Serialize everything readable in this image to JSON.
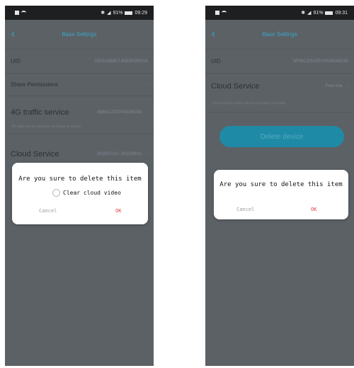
{
  "left": {
    "status": {
      "icons_left": "▮ ≋",
      "bluetooth": "✱",
      "signal": "◢",
      "battery_percent": "91%",
      "time": "09:29"
    },
    "nav": {
      "title": "Base Settings"
    },
    "uid": {
      "label": "UID",
      "value": "VEGUABMLTJKBSFDPDVA"
    },
    "share": {
      "label": "Share Permissions"
    },
    "traffic": {
      "label": "4G traffic service",
      "value": "8986112027043156283"
    },
    "traffic_note": "4G data service package recharge or inquiry",
    "cloud": {
      "label": "Cloud Service",
      "value": "2023/07/12--2023/08/11"
    },
    "dialog": {
      "title": "Are you sure to delete this item",
      "checkbox_label": "Clear cloud video",
      "cancel": "Cancel",
      "ok": "OK"
    }
  },
  "right": {
    "status": {
      "icons_left": "▮ ≋",
      "bluetooth": "✱",
      "signal": "◢",
      "battery_percent": "91%",
      "time": "09:31"
    },
    "nav": {
      "title": "Base Settings"
    },
    "uid": {
      "label": "UID",
      "value": "NFRKLDSXZFUHVRDMZUG"
    },
    "cloud": {
      "label": "Cloud Service",
      "value": "Free trial"
    },
    "cloud_note": "Cloud storage video service package purchase",
    "delete_button": "Delete device",
    "dialog": {
      "title": "Are you sure to delete this item",
      "cancel": "Cancel",
      "ok": "OK"
    }
  }
}
